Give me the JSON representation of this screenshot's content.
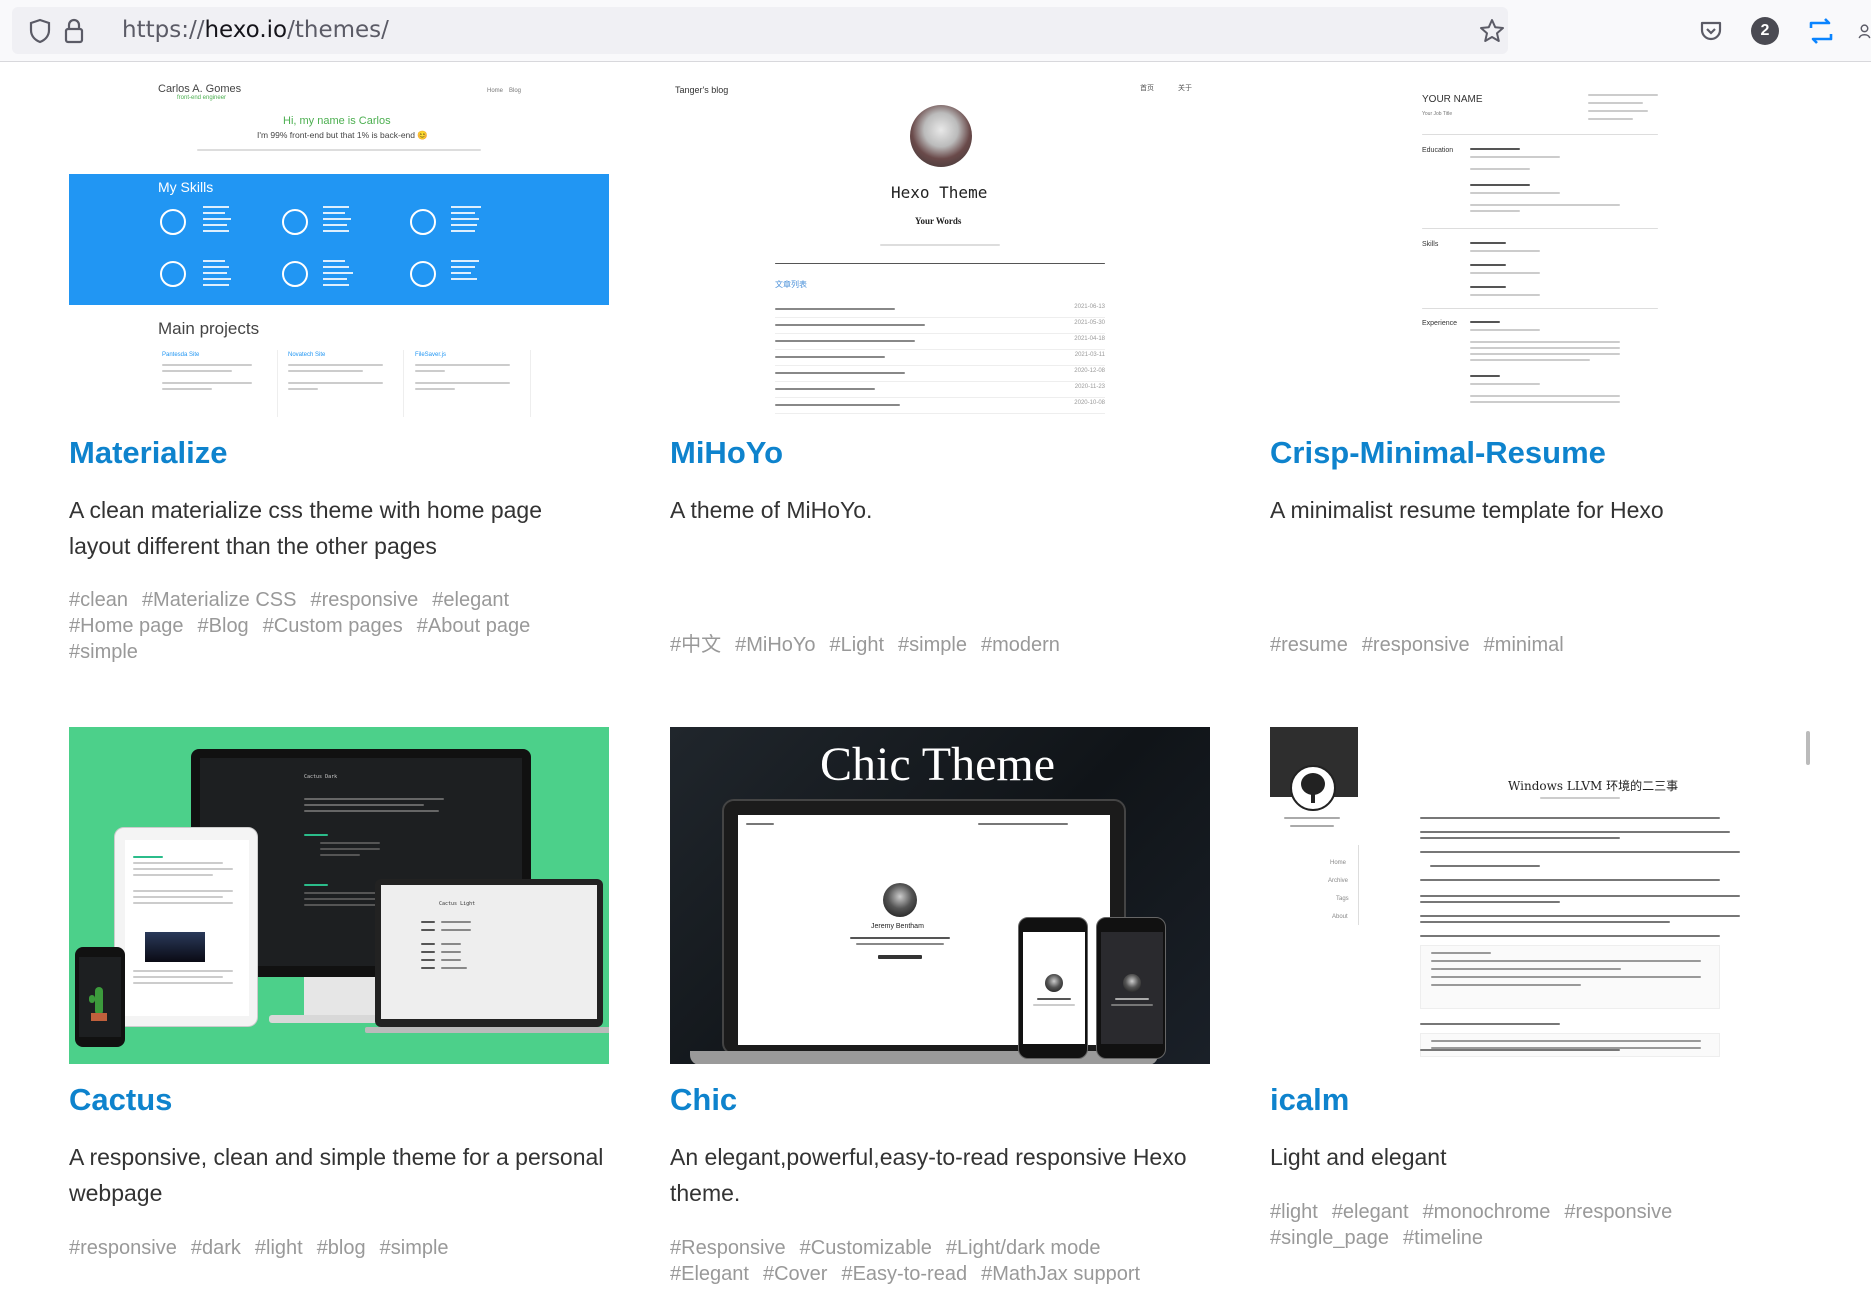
{
  "browser": {
    "url_prefix": "https://",
    "url_host": "hexo.io",
    "url_path": "/themes/",
    "badge_count": "2"
  },
  "themes": [
    {
      "name": "Materialize",
      "description": "A clean materialize css theme with home page layout different than the other pages",
      "tags": [
        "#clean",
        "#Materialize CSS",
        "#responsive",
        "#elegant",
        "#Home page",
        "#Blog",
        "#Custom pages",
        "#About page",
        "#simple"
      ],
      "preview": {
        "author": "Carlos A. Gomes",
        "role": "front-end engineer",
        "nav": [
          "Home",
          "Blog"
        ],
        "greeting": "Hi, my name is Carlos",
        "tagline": "I'm 99% front-end but that 1% is back-end 😊",
        "skills_title": "My Skills",
        "projects_title": "Main projects",
        "projects": [
          "Pantesda Site",
          "Novatech Site",
          "FileSaver.js"
        ]
      }
    },
    {
      "name": "MiHoYo",
      "description": "A theme of MiHoYo.",
      "tags": [
        "#中文",
        "#MiHoYo",
        "#Light",
        "#simple",
        "#modern"
      ],
      "preview": {
        "blog_name": "Tanger's blog",
        "nav": [
          "首页",
          "关于"
        ],
        "site_title": "Hexo Theme",
        "subtitle": "Your Words",
        "list_title": "文章列表",
        "dates": [
          "2021-06-13",
          "2021-05-30",
          "2021-04-18",
          "2021-03-11",
          "2020-12-08",
          "2020-11-23",
          "2020-10-08"
        ]
      }
    },
    {
      "name": "Crisp-Minimal-Resume",
      "description": "A minimalist resume template for Hexo",
      "tags": [
        "#resume",
        "#responsive",
        "#minimal"
      ],
      "preview": {
        "your_name": "YOUR NAME",
        "job_title": "Your Job Title",
        "sections": [
          "Education",
          "Skills",
          "Experience"
        ]
      }
    },
    {
      "name": "Cactus",
      "description": "A responsive, clean and simple theme for a personal webpage",
      "tags": [
        "#responsive",
        "#dark",
        "#light",
        "#blog",
        "#simple"
      ],
      "preview": {
        "dark_title": "Cactus Dark",
        "light_title": "Cactus Light"
      }
    },
    {
      "name": "Chic",
      "description": "An elegant,powerful,easy-to-read responsive Hexo theme.",
      "tags": [
        "#Responsive",
        "#Customizable",
        "#Light/dark mode",
        "#Elegant",
        "#Cover",
        "#Easy-to-read",
        "#MathJax support"
      ],
      "preview": {
        "headline": "Chic Theme",
        "person": "Jeremy Bentham"
      }
    },
    {
      "name": "icalm",
      "description": "Light and elegant",
      "tags": [
        "#light",
        "#elegant",
        "#monochrome",
        "#responsive",
        "#single_page",
        "#timeline"
      ],
      "preview": {
        "article_title": "Windows LLVM 环境的二三事",
        "menu": [
          "Home",
          "Archive",
          "Tags",
          "About"
        ]
      }
    }
  ],
  "colors": {
    "title_link": "#0e83cd",
    "tag_gray": "#999999",
    "skills_blue": "#2196f3",
    "cactus_green": "#4cd08a"
  }
}
